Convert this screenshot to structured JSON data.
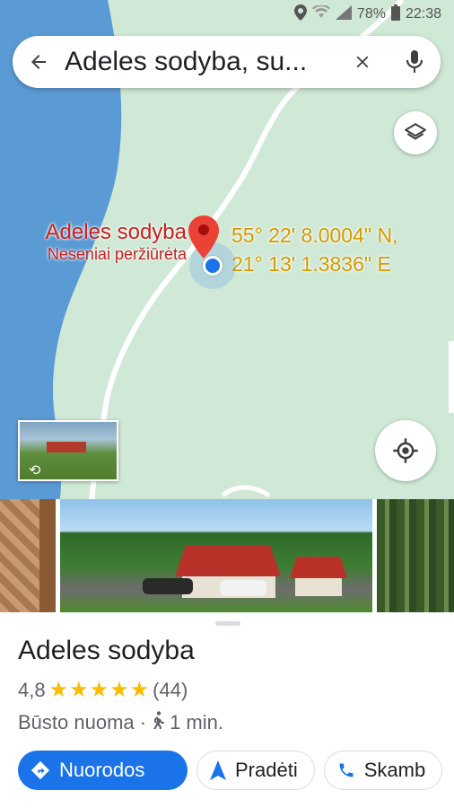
{
  "status_bar": {
    "battery": "78%",
    "time": "22:38"
  },
  "search": {
    "query": "Adeles sodyba, su..."
  },
  "map": {
    "place_name": "Adeles sodyba",
    "place_subtitle": "Neseniai peržiūrėta",
    "coord_lat": "55° 22' 8.0004\" N,",
    "coord_lon": "21° 13' 1.3836\" E"
  },
  "place": {
    "name": "Adeles sodyba",
    "rating": "4,8",
    "review_count": "(44)",
    "stars": 5,
    "category": "Būsto nuoma ·",
    "walk_time": "1 min."
  },
  "actions": {
    "directions": "Nuorodos",
    "start": "Pradėti",
    "call": "Skamb"
  },
  "colors": {
    "accent": "#1a73e8",
    "star": "#fbbc04",
    "pin": "#ea4335",
    "label": "#c5221f",
    "coords": "#d39b00",
    "land": "#cfe9d6",
    "water": "#5b9bd5"
  }
}
